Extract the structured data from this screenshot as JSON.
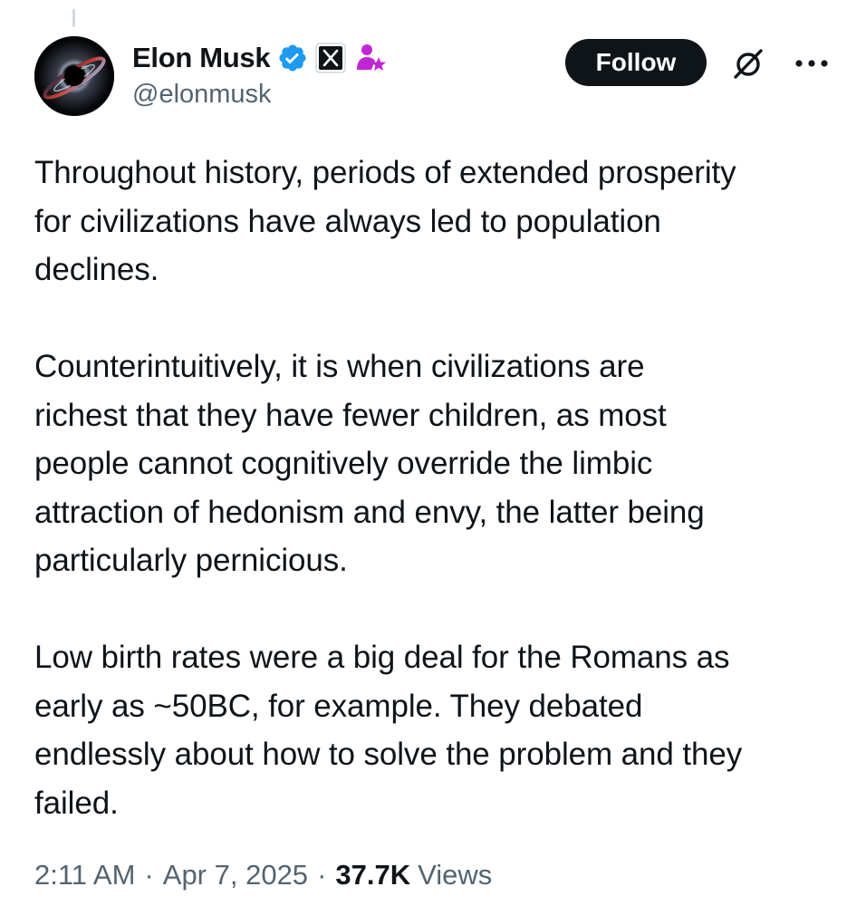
{
  "author": {
    "display_name": "Elon Musk",
    "handle": "@elonmusk",
    "icons": [
      "verified-badge-icon",
      "x-affiliate-badge-icon",
      "creator-star-icon"
    ],
    "verified_color": "#1d9bf0",
    "creator_color": "#c026d3"
  },
  "actions": {
    "follow_label": "Follow",
    "grok_icon": "grok-icon",
    "more_icon": "more-dots-icon"
  },
  "tweet": {
    "paragraph1": [
      "Throughout history, periods of extended prosperity",
      "for civilizations have always led to population",
      "declines."
    ],
    "paragraph2": [
      "Counterintuitively, it is when civilizations are",
      "richest that they have fewer children, as most",
      "people cannot cognitively override the limbic",
      "attraction of hedonism and envy, the latter being",
      "particularly pernicious."
    ],
    "paragraph3": [
      "Low birth rates were a big deal for the Romans as",
      "early as ~50BC, for example. They debated",
      "endlessly about how to solve the problem and they",
      "failed."
    ]
  },
  "meta": {
    "time": "2:11 AM",
    "separator": "·",
    "date": "Apr 7, 2025",
    "views_count": "37.7K",
    "views_label": "Views"
  },
  "colors": {
    "text": "#0f1419",
    "secondary": "#536471",
    "button_bg": "#0f1419",
    "button_text": "#ffffff"
  }
}
